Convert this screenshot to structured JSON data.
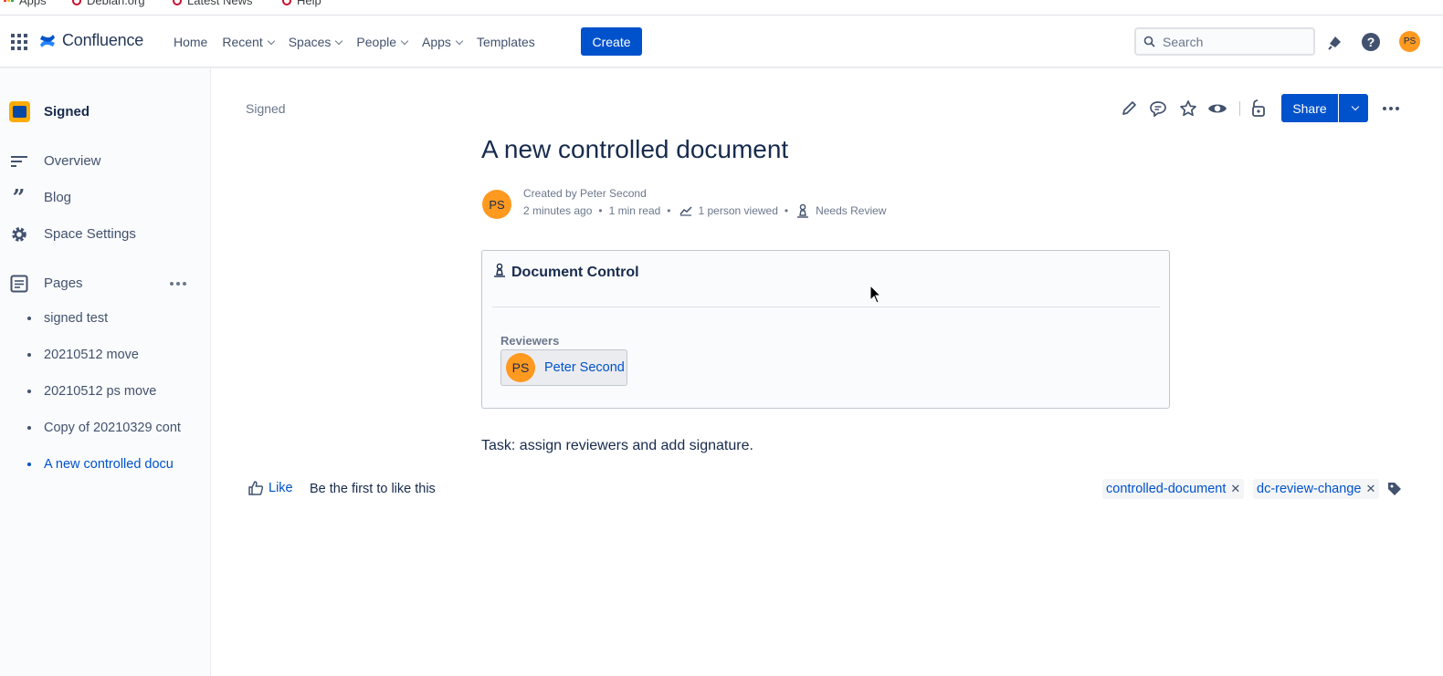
{
  "bookmarks": [
    {
      "label": "Apps",
      "icon": "apps-grid-icon"
    },
    {
      "label": "Debian.org",
      "icon": "debian-icon"
    },
    {
      "label": "Latest News",
      "icon": "debian-icon"
    },
    {
      "label": "Help",
      "icon": "debian-icon"
    }
  ],
  "topnav": {
    "logo": "Confluence",
    "items": [
      "Home",
      "Recent",
      "Spaces",
      "People",
      "Apps",
      "Templates"
    ],
    "create_label": "Create",
    "search_placeholder": "Search",
    "avatar_initials": "PS"
  },
  "sidebar": {
    "space_name": "Signed",
    "links": [
      {
        "label": "Overview",
        "icon": "overview-icon"
      },
      {
        "label": "Blog",
        "icon": "quote-icon"
      },
      {
        "label": "Space Settings",
        "icon": "gear-icon"
      }
    ],
    "pages_label": "Pages",
    "pages": [
      "signed test",
      "20210512 move",
      "20210512 ps move",
      "Copy of 20210329 cont",
      "A new controlled docu"
    ],
    "active_page_index": 4
  },
  "page": {
    "breadcrumb": "Signed",
    "share_label": "Share",
    "title": "A new controlled document",
    "byline": {
      "avatar_initials": "PS",
      "created_by": "Created by Peter Second",
      "time": "2 minutes ago",
      "read_time": "1 min read",
      "views": "1 person viewed",
      "status": "Needs Review"
    },
    "document_control": {
      "heading": "Document Control",
      "reviewers_label": "Reviewers",
      "reviewer": {
        "initials": "PS",
        "name": "Peter Second"
      }
    },
    "body_text": "Task: assign reviewers and add signature.",
    "like_label": "Like",
    "like_hint": "Be the first to like this",
    "labels": [
      "controlled-document",
      "dc-review-change"
    ]
  },
  "colors": {
    "brand_blue": "#0052cc",
    "avatar_orange": "#ff991f",
    "space_icon": "#ffab00"
  }
}
